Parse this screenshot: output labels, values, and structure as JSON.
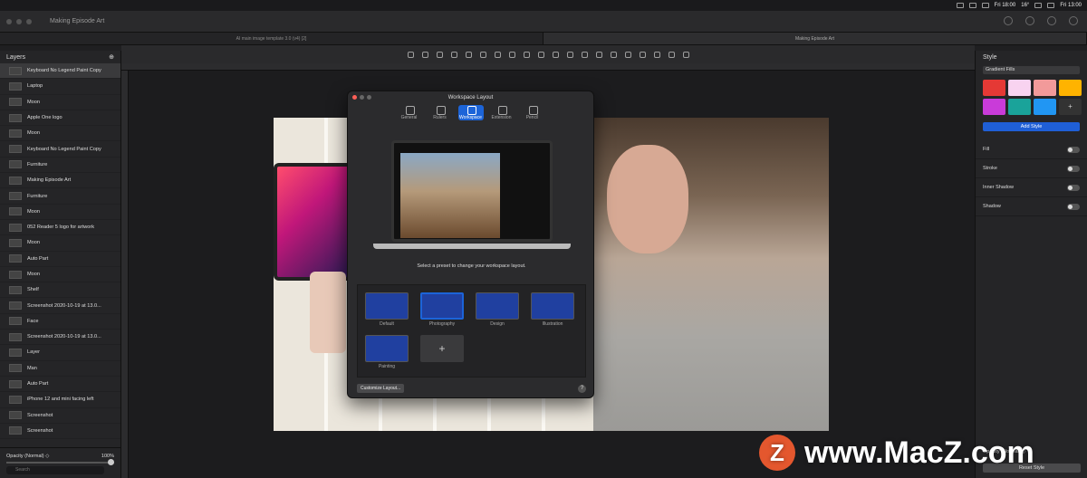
{
  "menubar": {
    "date": "Fri 18:00",
    "temp": "16°",
    "clock": "Fri 13:00"
  },
  "window": {
    "title": "Making Episode Art"
  },
  "tabs": [
    {
      "label": "AI main image template 3.0 (v4) [2]"
    },
    {
      "label": "Making Episode Art"
    }
  ],
  "left_panel": {
    "title": "Layers",
    "layers": [
      {
        "label": "Keyboard No Legend Paint Copy"
      },
      {
        "label": "Laptop"
      },
      {
        "label": "Moon"
      },
      {
        "label": "Apple One logo"
      },
      {
        "label": "Moon"
      },
      {
        "label": "Keyboard No Legend Paint Copy"
      },
      {
        "label": "Furniture"
      },
      {
        "label": "Making Episode Art"
      },
      {
        "label": "Furniture"
      },
      {
        "label": "Moon"
      },
      {
        "label": "052 Reader 5 logo for artwork"
      },
      {
        "label": "Moon"
      },
      {
        "label": "Auto Part"
      },
      {
        "label": "Moon"
      },
      {
        "label": "Shelf"
      },
      {
        "label": "Screenshot 2020-10-19 at 13.0..."
      },
      {
        "label": "Face"
      },
      {
        "label": "Screenshot 2020-10-19 at 13.0..."
      },
      {
        "label": "Layer"
      },
      {
        "label": "Man"
      },
      {
        "label": "Auto Part"
      },
      {
        "label": "iPhone 12 and mini facing left"
      },
      {
        "label": "Screenshot"
      },
      {
        "label": "Screenshot"
      }
    ],
    "opacity_label": "Opacity (Normal) ◇",
    "opacity_value": "100%",
    "search_placeholder": "Search"
  },
  "right_panel": {
    "title": "Style",
    "fills_select": "Gradient Fills",
    "swatches": [
      "#e53935",
      "#f8d3f0",
      "#f29a9a",
      "#ffb300",
      "#c93bd9",
      "#1aa39a",
      "#2196f3"
    ],
    "add_style": "Add Style",
    "rows": [
      {
        "label": "Fill"
      },
      {
        "label": "Stroke"
      },
      {
        "label": "Inner Shadow"
      },
      {
        "label": "Shadow"
      }
    ],
    "bottom_label": "Opacity (Normal) ◇",
    "reset_style": "Reset Style"
  },
  "dialog": {
    "title": "Workspace Layout",
    "tabs": [
      {
        "label": "General"
      },
      {
        "label": "Rulers"
      },
      {
        "label": "Workspace"
      },
      {
        "label": "Extension"
      },
      {
        "label": "Pencil"
      }
    ],
    "caption": "Select a preset to change your workspace layout.",
    "presets": [
      {
        "label": "Default"
      },
      {
        "label": "Photography"
      },
      {
        "label": "Design"
      },
      {
        "label": "Illustration"
      },
      {
        "label": "Painting"
      }
    ],
    "add": "+",
    "customize": "Customize Layout...",
    "help": "?"
  },
  "watermark": {
    "text": "www.MacZ.com",
    "logo": "Z"
  }
}
